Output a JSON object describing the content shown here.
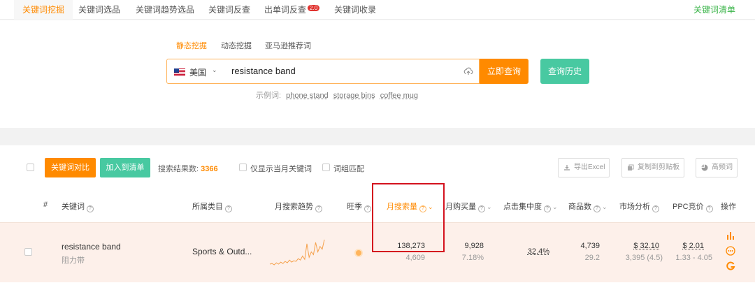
{
  "nav": {
    "tabs": [
      "关键词挖掘",
      "关键词选品",
      "关键词趋势选品",
      "关键词反查",
      "出单词反查",
      "关键词收录"
    ],
    "badge": "2.0",
    "right_link": "关键词清单"
  },
  "search": {
    "modes": [
      "静态挖掘",
      "动态挖掘",
      "亚马逊推荐词"
    ],
    "country": "美国",
    "query": "resistance band",
    "submit_label": "立即查询",
    "history_label": "查询历史",
    "examples_label": "示例词:",
    "examples": [
      "phone stand",
      "storage bins",
      "coffee mug"
    ]
  },
  "toolbar": {
    "compare_label": "关键词对比",
    "add_label": "加入到清单",
    "count_label": "搜索结果数:",
    "count_value": "3366",
    "opt_month": "仅显示当月关键词",
    "opt_phrase": "词组匹配",
    "export_label": "导出Excel",
    "copy_label": "复制到剪贴板",
    "freq_label": "高频词"
  },
  "table": {
    "headers": {
      "index": "#",
      "keyword": "关键词",
      "category": "所属类目",
      "trend": "月搜索趋势",
      "season": "旺季",
      "monthly_search": "月搜索量",
      "monthly_purchase": "月购买量",
      "click_concentration": "点击集中度",
      "product_count": "商品数",
      "market": "市场分析",
      "ppc": "PPC竞价",
      "actions": "操作"
    },
    "row": {
      "keyword": "resistance band",
      "keyword_cn": "阻力带",
      "category": "Sports & Outd...",
      "monthly_search": "138,273",
      "monthly_search_sub": "4,609",
      "monthly_purchase": "9,928",
      "purchase_rate": "7.18%",
      "click_concentration": "32.4%",
      "product_count": "4,739",
      "product_sub": "29.2",
      "market_price": "$ 32.10",
      "market_sub": "3,395 (4.5)",
      "ppc": "$ 2.01",
      "ppc_range": "1.33 - 4.05",
      "trend": [
        12,
        13,
        11,
        14,
        12,
        15,
        13,
        16,
        14,
        18,
        15,
        17,
        16,
        20,
        18,
        24,
        19,
        42,
        22,
        30,
        26,
        44,
        30,
        38,
        34,
        48
      ]
    }
  },
  "colors": {
    "accent": "#ff8a00",
    "green": "#48c9a1",
    "row_highlight": "#fdf0ea",
    "annotation": "#d4121e"
  }
}
